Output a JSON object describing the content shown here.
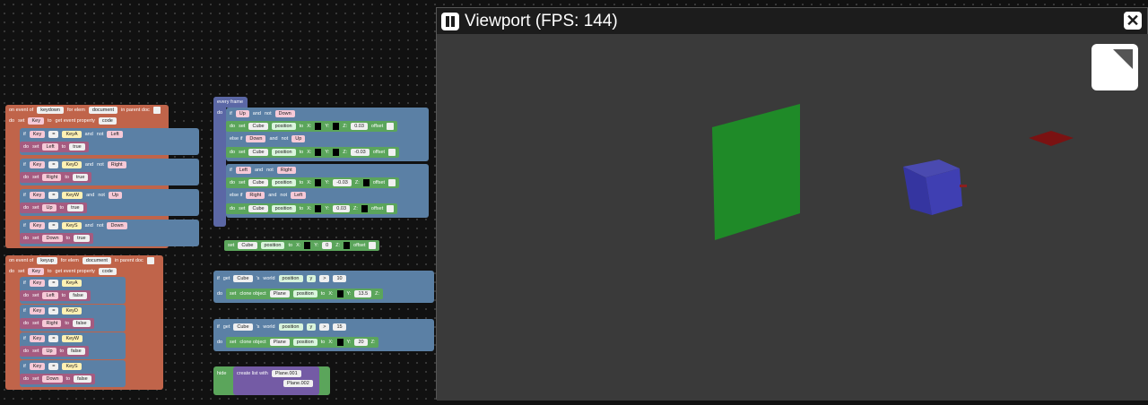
{
  "viewport": {
    "title": "Viewport (FPS: 144)",
    "pause_icon": "pause-icon",
    "close_icon": "close-icon"
  },
  "blocks": {
    "keydown": {
      "event": "on event of",
      "event_name": "keydown",
      "for_elem": "for elem",
      "elem": "document",
      "in_parent": "in parent doc",
      "set": "set",
      "var": "Key",
      "to": "to",
      "get_prop": "get event property",
      "prop": "code",
      "ifs": [
        {
          "if": "if",
          "key": "Key",
          "eq": "=",
          "val": "KeyA",
          "and": "and",
          "not": "not",
          "flag": "Left",
          "do": "do",
          "set": "set",
          "var": "Left",
          "to": "to",
          "bool": "true"
        },
        {
          "if": "if",
          "key": "Key",
          "eq": "=",
          "val": "KeyD",
          "and": "and",
          "not": "not",
          "flag": "Right",
          "do": "do",
          "set": "set",
          "var": "Right",
          "to": "to",
          "bool": "true"
        },
        {
          "if": "if",
          "key": "Key",
          "eq": "=",
          "val": "KeyW",
          "and": "and",
          "not": "not",
          "flag": "Up",
          "do": "do",
          "set": "set",
          "var": "Up",
          "to": "to",
          "bool": "true"
        },
        {
          "if": "if",
          "key": "Key",
          "eq": "=",
          "val": "KeyS",
          "and": "and",
          "not": "not",
          "flag": "Down",
          "do": "do",
          "set": "set",
          "var": "Down",
          "to": "to",
          "bool": "true"
        }
      ]
    },
    "keyup": {
      "event": "on event of",
      "event_name": "keyup",
      "for_elem": "for elem",
      "elem": "document",
      "in_parent": "in parent doc",
      "set": "set",
      "var": "Key",
      "to": "to",
      "get_prop": "get event property",
      "prop": "code",
      "ifs": [
        {
          "if": "if",
          "key": "Key",
          "eq": "=",
          "val": "KeyA",
          "do": "do",
          "set": "set",
          "var": "Left",
          "to": "to",
          "bool": "false"
        },
        {
          "if": "if",
          "key": "Key",
          "eq": "=",
          "val": "KeyD",
          "do": "do",
          "set": "set",
          "var": "Right",
          "to": "to",
          "bool": "false"
        },
        {
          "if": "if",
          "key": "Key",
          "eq": "=",
          "val": "KeyW",
          "do": "do",
          "set": "set",
          "var": "Up",
          "to": "to",
          "bool": "false"
        },
        {
          "if": "if",
          "key": "Key",
          "eq": "=",
          "val": "KeyS",
          "do": "do",
          "set": "set",
          "var": "Down",
          "to": "to",
          "bool": "false"
        }
      ]
    },
    "frame": {
      "title": "every frame",
      "do": "do",
      "branches": [
        {
          "kw": "if",
          "a": "Up",
          "and": "and",
          "not": "not",
          "b": "Down",
          "do": "do",
          "set": "set",
          "obj": "Cube",
          "prop": "position",
          "to": "to",
          "x": "X:",
          "y": "Y:",
          "z": "Z:",
          "zval": "0.03",
          "offset": "offset"
        },
        {
          "kw": "else if",
          "a": "Down",
          "and": "and",
          "not": "not",
          "b": "Up",
          "do": "do",
          "set": "set",
          "obj": "Cube",
          "prop": "position",
          "to": "to",
          "x": "X:",
          "y": "Y:",
          "z": "Z:",
          "zval": "-0.03",
          "offset": "offset"
        },
        {
          "kw": "if",
          "a": "Left",
          "and": "and",
          "not": "not",
          "b": "Right",
          "do": "do",
          "set": "set",
          "obj": "Cube",
          "prop": "position",
          "to": "to",
          "x": "X:",
          "y": "Y:",
          "yval": "-0.03",
          "z": "Z:",
          "offset": "offset"
        },
        {
          "kw": "else if",
          "a": "Right",
          "and": "and",
          "not": "not",
          "b": "Left",
          "do": "do",
          "set": "set",
          "obj": "Cube",
          "prop": "position",
          "to": "to",
          "x": "X:",
          "y": "Y:",
          "yval": "0.03",
          "z": "Z:",
          "offset": "offset"
        }
      ]
    },
    "setcube": {
      "set": "set",
      "obj": "Cube",
      "prop": "position",
      "to": "to",
      "x": "X:",
      "y": "Y:",
      "yval": "0",
      "z": "Z:",
      "offset": "offset"
    },
    "clone1": {
      "if": "if",
      "get": "get",
      "obj": "Cube",
      "s": "'s",
      "world": "world",
      "prop": "position",
      "axis": "y",
      "op": ">",
      "val": "10",
      "do": "do",
      "set": "set",
      "clone": "clone object",
      "plane": "Plane",
      "prop2": "position",
      "to": "to",
      "x": "X:",
      "y": "Y:",
      "yval": "13.5",
      "z": "Z:",
      "offset": "offset"
    },
    "clone2": {
      "if": "if",
      "get": "get",
      "obj": "Cube",
      "s": "'s",
      "world": "world",
      "prop": "position",
      "axis": "y",
      "op": ">",
      "val": "15",
      "do": "do",
      "set": "set",
      "clone": "clone object",
      "plane": "Plane",
      "prop2": "position",
      "to": "to",
      "x": "X:",
      "y": "Y:",
      "yval": "20",
      "z": "Z:",
      "offset": "offset"
    },
    "hide": {
      "hide": "hide",
      "create": "create list with",
      "items": [
        "Plane.001",
        "Plane.002"
      ]
    }
  },
  "colors": {
    "event": "#c0644a",
    "ifblock": "#5b80a5",
    "setvar": "#a55b80",
    "logic": "#5b67a5",
    "threed": "#5ba55b",
    "list": "#745ba5",
    "bg": "#111111",
    "scene": "#3a3a3a"
  }
}
